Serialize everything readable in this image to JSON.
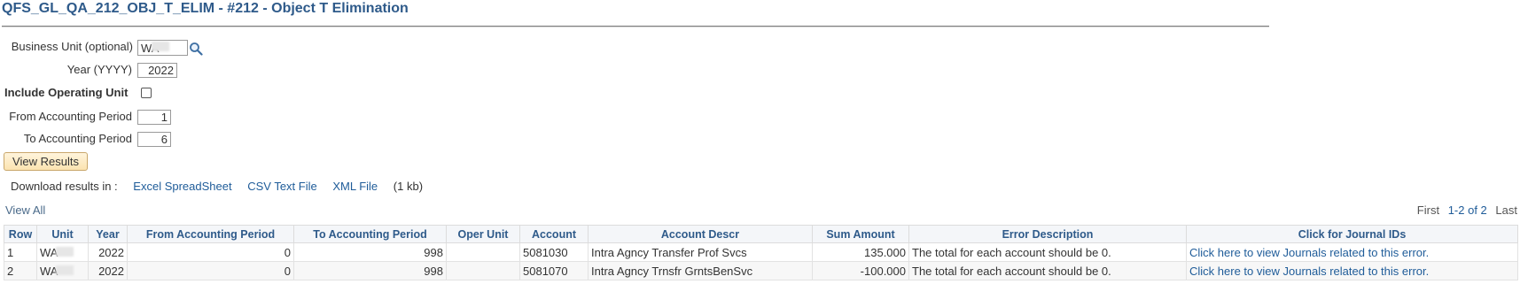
{
  "page": {
    "title": "QFS_GL_QA_212_OBJ_T_ELIM - #212 - Object T Elimination"
  },
  "form": {
    "business_unit_label": "Business Unit (optional)",
    "business_unit_value": "WA",
    "year_label": "Year (YYYY)",
    "year_value": "2022",
    "include_operating_unit_label": "Include Operating Unit",
    "include_operating_unit_checked": false,
    "from_period_label": "From Accounting Period",
    "from_period_value": "1",
    "to_period_label": "To Accounting Period",
    "to_period_value": "6",
    "view_results_label": "View Results"
  },
  "download": {
    "prefix": "Download results in :",
    "excel": "Excel SpreadSheet",
    "csv": "CSV Text File",
    "xml": "XML File",
    "size": "(1 kb)"
  },
  "grid_nav": {
    "view_all": "View All",
    "first": "First",
    "count": "1-2 of 2",
    "last": "Last"
  },
  "table": {
    "headers": [
      "Row",
      "Unit",
      "Year",
      "From Accounting Period",
      "To Accounting Period",
      "Oper Unit",
      "Account",
      "Account Descr",
      "Sum Amount",
      "Error Description",
      "Click for Journal IDs"
    ],
    "rows": [
      {
        "row": "1",
        "unit": "WA",
        "year": "2022",
        "from_period": "0",
        "to_period": "998",
        "oper_unit": "",
        "account": "5081030",
        "account_descr": "Intra Agncy Transfer Prof Svcs",
        "sum_amount": "135.000",
        "error_description": "The total for each account should be 0.",
        "journal_link": "Click here to view Journals related to this error."
      },
      {
        "row": "2",
        "unit": "WA",
        "year": "2022",
        "from_period": "0",
        "to_period": "998",
        "oper_unit": "",
        "account": "5081070",
        "account_descr": "Intra Agncy Trnsfr GrntsBenSvc",
        "sum_amount": "-100.000",
        "error_description": "The total for each account should be 0.",
        "journal_link": "Click here to view Journals related to this error."
      }
    ]
  },
  "icons": {
    "lookup": "magnifier-icon"
  },
  "colors": {
    "title": "#2e5a8a",
    "link": "#1f5c99",
    "header_bg": "#f4f6f9",
    "button_bg": "#fbe3b0"
  }
}
